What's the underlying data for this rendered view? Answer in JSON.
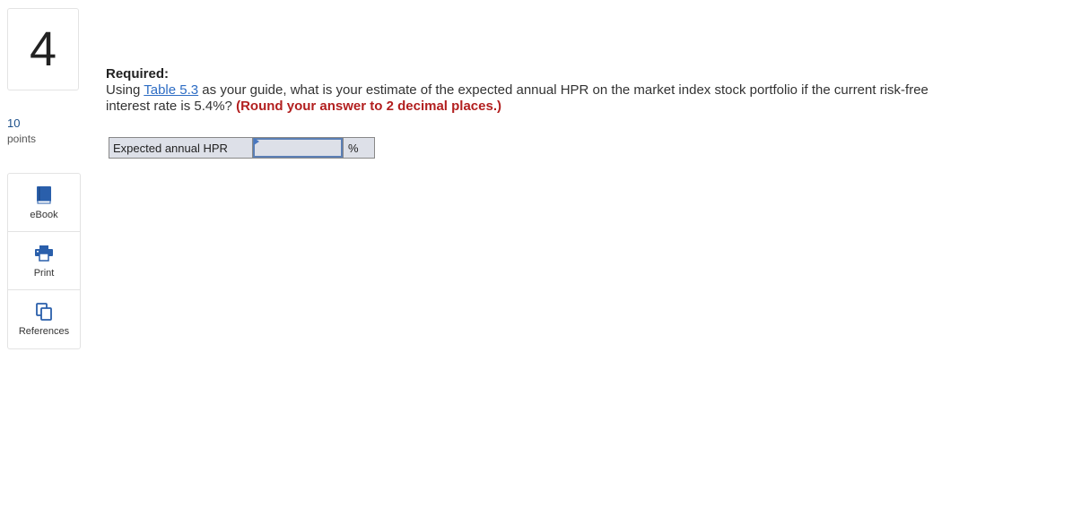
{
  "question": {
    "number": "4",
    "points_value": "10",
    "points_label": "points"
  },
  "tools": [
    {
      "label": "eBook",
      "icon": "book-icon"
    },
    {
      "label": "Print",
      "icon": "printer-icon"
    },
    {
      "label": "References",
      "icon": "copy-pages-icon"
    }
  ],
  "content": {
    "required_label": "Required:",
    "text_before_link": "Using ",
    "link_text": "Table 5.3",
    "text_after_link": " as your guide, what is your estimate of the expected annual HPR on the market index stock portfolio if the current risk-free interest rate is 5.4%? ",
    "instruction": "(Round your answer to 2 decimal places.)"
  },
  "answer": {
    "label": "Expected annual HPR",
    "value": "",
    "unit": "%"
  },
  "colors": {
    "link": "#2e6dc4",
    "instruction": "#b21f1f",
    "points": "#1b4f8a",
    "icon_blue": "#2a5fab",
    "input_bg": "#dde0e8"
  }
}
